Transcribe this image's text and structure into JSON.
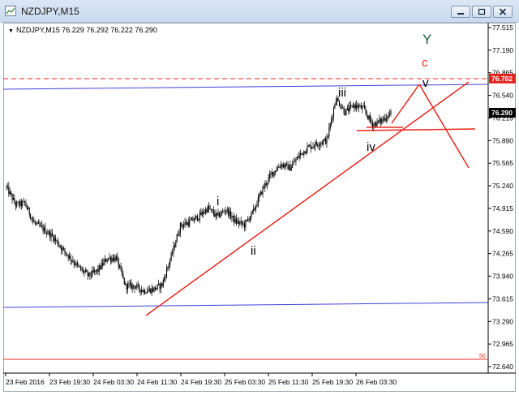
{
  "window": {
    "title": "NZDJPY,M15",
    "symbol_line": "NZDJPY,M15  76.229 76.292 76.222 76.290"
  },
  "colors": {
    "bull_bear": "#000000",
    "blue_line": "#3b43d9",
    "red": "#e8281c",
    "price_tag_bg": "#000000",
    "resistance_tag_bg": "#e0271f"
  },
  "icons": [
    "chart-app-icon",
    "minimize-icon",
    "restore-icon",
    "close-icon",
    "dropdown-triangle-icon"
  ],
  "chart_data": {
    "type": "candlestick",
    "symbol": "NZDJPY",
    "timeframe": "M15",
    "ohlc": {
      "open": 76.229,
      "high": 76.292,
      "low": 76.222,
      "close": 76.29
    },
    "ylim": [
      72.64,
      77.515
    ],
    "y_ticks": [
      "77.515",
      "77.190",
      "76.865",
      "76.540",
      "76.215",
      "75.890",
      "75.565",
      "75.240",
      "74.915",
      "74.590",
      "74.265",
      "73.940",
      "73.615",
      "73.290",
      "72.965",
      "72.640"
    ],
    "x_ticks": [
      "23 Feb 2016",
      "23 Feb 19:30",
      "24 Feb 03:30",
      "24 Feb 11:30",
      "24 Feb 19:30",
      "25 Feb 03:30",
      "25 Feb 11:30",
      "25 Feb 19:30",
      "26 Feb 03:30"
    ],
    "current_price_tag": "76.290",
    "resistance_tag": "76.782",
    "level_label": "50",
    "wave_labels": [
      "i",
      "ii",
      "iii",
      "iv",
      "v",
      "c",
      "Y"
    ],
    "series": [
      {
        "bar": 0,
        "value": 75.22
      },
      {
        "bar": 8,
        "value": 74.97
      },
      {
        "bar": 16,
        "value": 74.99
      },
      {
        "bar": 24,
        "value": 74.71
      },
      {
        "bar": 32,
        "value": 74.62
      },
      {
        "bar": 40,
        "value": 74.52
      },
      {
        "bar": 48,
        "value": 74.35
      },
      {
        "bar": 56,
        "value": 74.2
      },
      {
        "bar": 64,
        "value": 74.05
      },
      {
        "bar": 72,
        "value": 73.95
      },
      {
        "bar": 80,
        "value": 74.03
      },
      {
        "bar": 88,
        "value": 74.2
      },
      {
        "bar": 96,
        "value": 74.2
      },
      {
        "bar": 104,
        "value": 73.8
      },
      {
        "bar": 112,
        "value": 73.8
      },
      {
        "bar": 120,
        "value": 73.73
      },
      {
        "bar": 128,
        "value": 73.75
      },
      {
        "bar": 136,
        "value": 73.82
      },
      {
        "bar": 144,
        "value": 74.23
      },
      {
        "bar": 152,
        "value": 74.67
      },
      {
        "bar": 160,
        "value": 74.72
      },
      {
        "bar": 168,
        "value": 74.8
      },
      {
        "bar": 176,
        "value": 74.92
      },
      {
        "bar": 184,
        "value": 74.8
      },
      {
        "bar": 192,
        "value": 74.9
      },
      {
        "bar": 200,
        "value": 74.73
      },
      {
        "bar": 208,
        "value": 74.68
      },
      {
        "bar": 216,
        "value": 74.88
      },
      {
        "bar": 224,
        "value": 75.2
      },
      {
        "bar": 232,
        "value": 75.42
      },
      {
        "bar": 240,
        "value": 75.55
      },
      {
        "bar": 248,
        "value": 75.5
      },
      {
        "bar": 256,
        "value": 75.68
      },
      {
        "bar": 264,
        "value": 75.8
      },
      {
        "bar": 272,
        "value": 75.85
      },
      {
        "bar": 280,
        "value": 75.9
      },
      {
        "bar": 288,
        "value": 76.5
      },
      {
        "bar": 296,
        "value": 76.3
      },
      {
        "bar": 304,
        "value": 76.4
      },
      {
        "bar": 312,
        "value": 76.35
      },
      {
        "bar": 320,
        "value": 76.12
      },
      {
        "bar": 328,
        "value": 76.18
      },
      {
        "bar": 336,
        "value": 76.29
      }
    ]
  }
}
